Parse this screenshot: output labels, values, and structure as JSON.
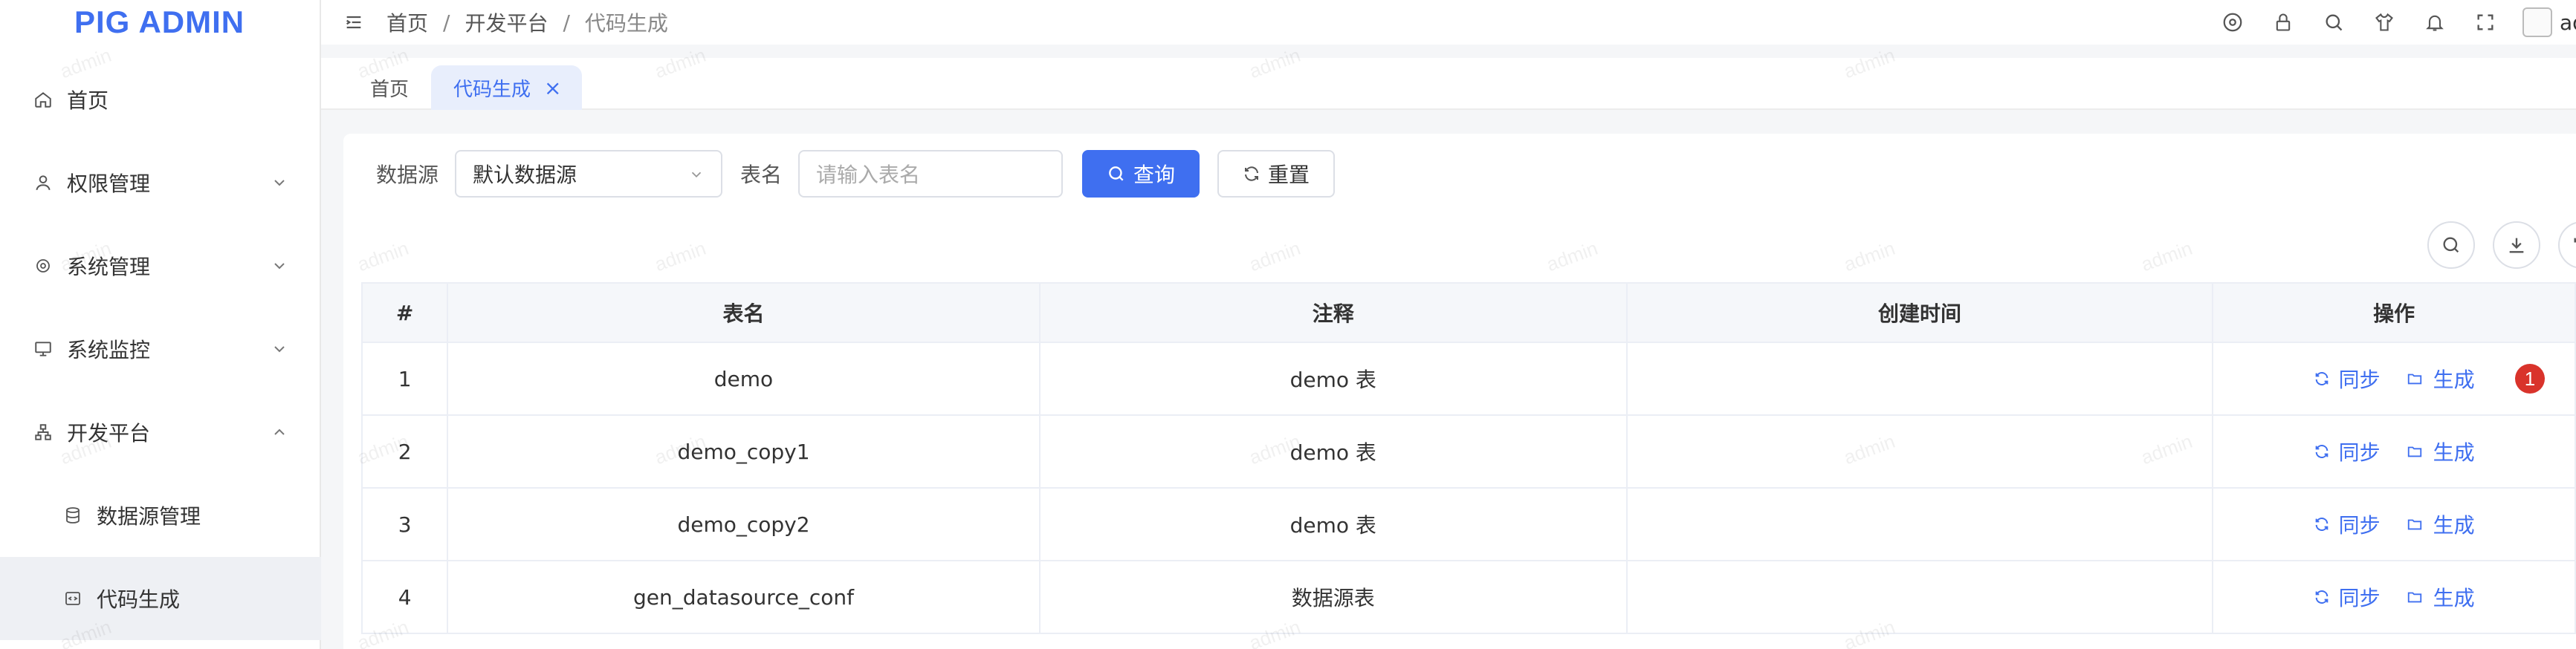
{
  "app": {
    "title": "PIG ADMIN"
  },
  "sidebar": {
    "items": [
      {
        "label": "首页",
        "icon": "home-icon"
      },
      {
        "label": "权限管理",
        "icon": "user-icon"
      },
      {
        "label": "系统管理",
        "icon": "gear-icon"
      },
      {
        "label": "系统监控",
        "icon": "monitor-icon"
      },
      {
        "label": "开发平台",
        "icon": "tree-icon"
      },
      {
        "label": "数据源管理",
        "icon": "database-icon"
      },
      {
        "label": "代码生成",
        "icon": "code-icon"
      }
    ]
  },
  "header": {
    "breadcrumb": [
      "首页",
      "开发平台",
      "代码生成"
    ],
    "separator": "/",
    "user_name": "admin"
  },
  "tabs": [
    {
      "label": "首页"
    },
    {
      "label": "代码生成"
    }
  ],
  "search": {
    "datasource_label": "数据源",
    "datasource_value": "默认数据源",
    "table_label": "表名",
    "table_placeholder": "请输入表名",
    "query_label": "查询",
    "reset_label": "重置"
  },
  "table": {
    "columns": [
      "#",
      "表名",
      "注释",
      "创建时间",
      "操作"
    ],
    "rows": [
      {
        "index": "1",
        "name": "demo",
        "comment": "demo 表",
        "created": ""
      },
      {
        "index": "2",
        "name": "demo_copy1",
        "comment": "demo 表",
        "created": ""
      },
      {
        "index": "3",
        "name": "demo_copy2",
        "comment": "demo 表",
        "created": ""
      },
      {
        "index": "4",
        "name": "gen_datasource_conf",
        "comment": "数据源表",
        "created": ""
      }
    ],
    "actions": {
      "sync": "同步",
      "generate": "生成"
    }
  },
  "badge": {
    "count": "1"
  },
  "watermark": "admin",
  "colors": {
    "primary": "#3f6ff0",
    "badge": "#d9332b"
  }
}
